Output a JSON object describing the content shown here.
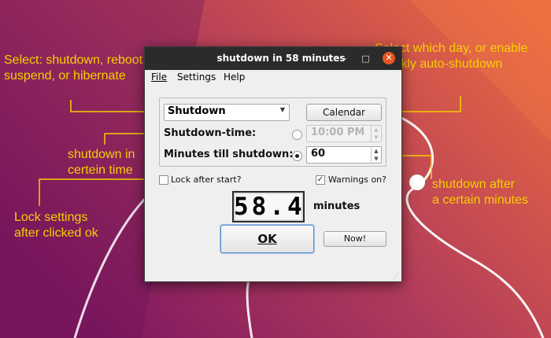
{
  "annotations": {
    "select_mode": [
      "Select: shutdown, reboot,",
      "suspend, or hibernate"
    ],
    "select_day": [
      "Select which day, or enable",
      "weekly auto-shutdown"
    ],
    "certain_time": [
      "shutdown in",
      "certein time"
    ],
    "after_minutes": [
      "shutdown after",
      "a certain minutes"
    ],
    "lock_settings": [
      "Lock settings",
      "after clicked ok"
    ]
  },
  "window": {
    "title": "shutdown in 58 minutes",
    "minimize_glyph": "–",
    "maximize_glyph": "□",
    "close_glyph": "✕"
  },
  "menu": {
    "file": "File",
    "settings": "Settings",
    "help": "Help"
  },
  "form": {
    "mode_value": "Shutdown",
    "calendar_label": "Calendar",
    "shutdown_time_label": "Shutdown-time:",
    "shutdown_time_value": "10:00 PM",
    "shutdown_time_selected": false,
    "minutes_label": "Minutes till shutdown:",
    "minutes_value": "60",
    "minutes_selected": true,
    "lock_label": "Lock after start?",
    "lock_checked": false,
    "warnings_label": "Warnings on?",
    "warnings_checked": true,
    "countdown": "58.4",
    "countdown_unit": "minutes",
    "ok_label": "OK",
    "now_label": "Now!"
  },
  "colors": {
    "annotation": "#f5d000",
    "close_button": "#e95420",
    "titlebar": "#2b2b2b"
  }
}
